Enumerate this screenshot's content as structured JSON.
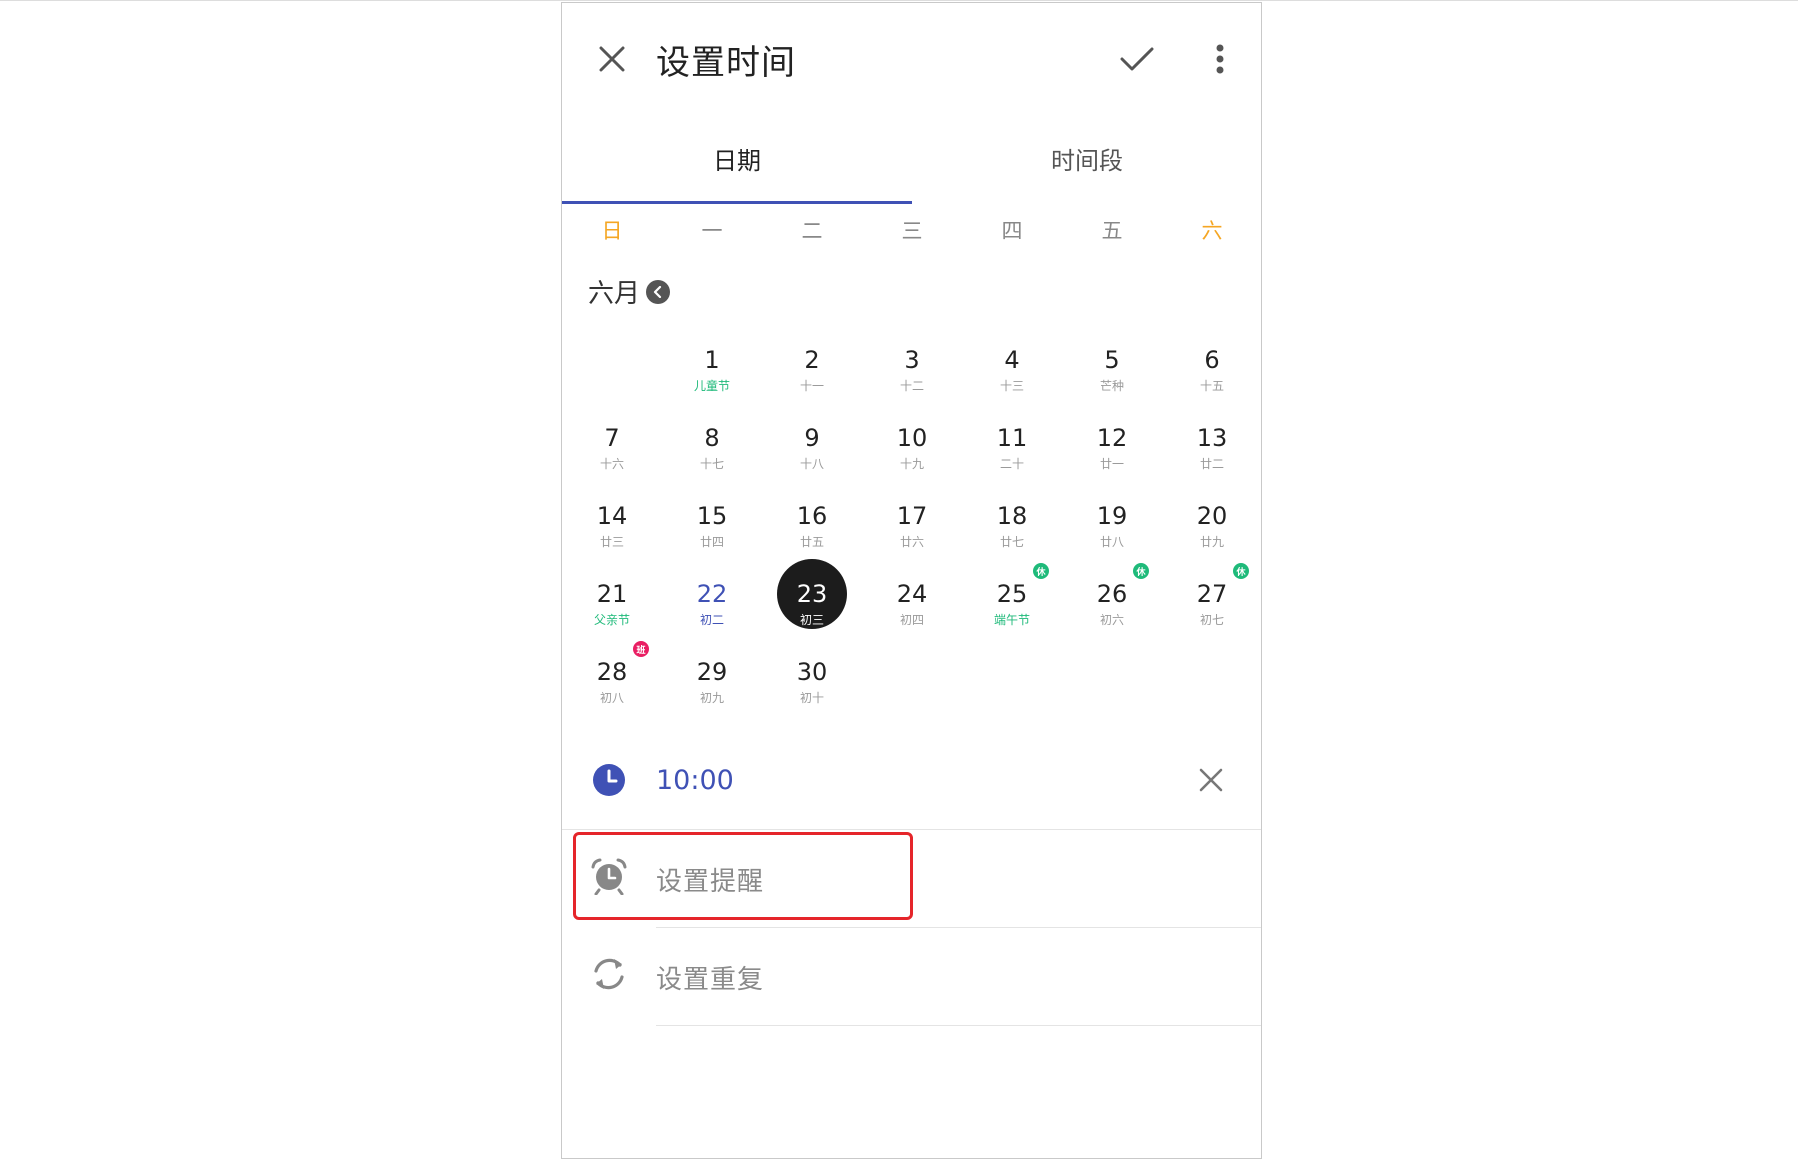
{
  "header": {
    "title": "设置时间"
  },
  "tabs": [
    {
      "label": "日期",
      "active": true
    },
    {
      "label": "时间段",
      "active": false
    }
  ],
  "weekdays": [
    "日",
    "一",
    "二",
    "三",
    "四",
    "五",
    "六"
  ],
  "month": {
    "label": "六月"
  },
  "calendar": {
    "days": [
      {
        "num": "1",
        "sub": "儿童节"
      },
      {
        "num": "2",
        "sub": "十一"
      },
      {
        "num": "3",
        "sub": "十二"
      },
      {
        "num": "4",
        "sub": "十三"
      },
      {
        "num": "5",
        "sub": "芒种"
      },
      {
        "num": "6",
        "sub": "十五"
      },
      {
        "num": "7",
        "sub": "十六"
      },
      {
        "num": "8",
        "sub": "十七"
      },
      {
        "num": "9",
        "sub": "十八"
      },
      {
        "num": "10",
        "sub": "十九"
      },
      {
        "num": "11",
        "sub": "二十"
      },
      {
        "num": "12",
        "sub": "廿一"
      },
      {
        "num": "13",
        "sub": "廿二"
      },
      {
        "num": "14",
        "sub": "廿三"
      },
      {
        "num": "15",
        "sub": "廿四"
      },
      {
        "num": "16",
        "sub": "廿五"
      },
      {
        "num": "17",
        "sub": "廿六"
      },
      {
        "num": "18",
        "sub": "廿七"
      },
      {
        "num": "19",
        "sub": "廿八"
      },
      {
        "num": "20",
        "sub": "廿九"
      },
      {
        "num": "21",
        "sub": "父亲节"
      },
      {
        "num": "22",
        "sub": "初二"
      },
      {
        "num": "23",
        "sub": "初三"
      },
      {
        "num": "24",
        "sub": "初四"
      },
      {
        "num": "25",
        "sub": "端午节",
        "badge": "休"
      },
      {
        "num": "26",
        "sub": "初六",
        "badge": "休"
      },
      {
        "num": "27",
        "sub": "初七",
        "badge": "休"
      },
      {
        "num": "28",
        "sub": "初八",
        "badge": "班"
      },
      {
        "num": "29",
        "sub": "初九"
      },
      {
        "num": "30",
        "sub": "初十"
      }
    ]
  },
  "time": {
    "value": "10:00"
  },
  "options": {
    "reminder_label": "设置提醒",
    "repeat_label": "设置重复"
  },
  "colors": {
    "accent": "#3f51b5",
    "weekend": "#f5a623",
    "festival": "#1fba7a",
    "rest_badge": "#1fba7a",
    "work_badge": "#e91e63",
    "selected": "#1c1c1c",
    "highlight": "#e5252a"
  },
  "icons": [
    "close-icon",
    "check-icon",
    "more-vertical-icon",
    "chevron-left-icon",
    "clock-icon",
    "alarm-clock-icon",
    "repeat-icon"
  ]
}
